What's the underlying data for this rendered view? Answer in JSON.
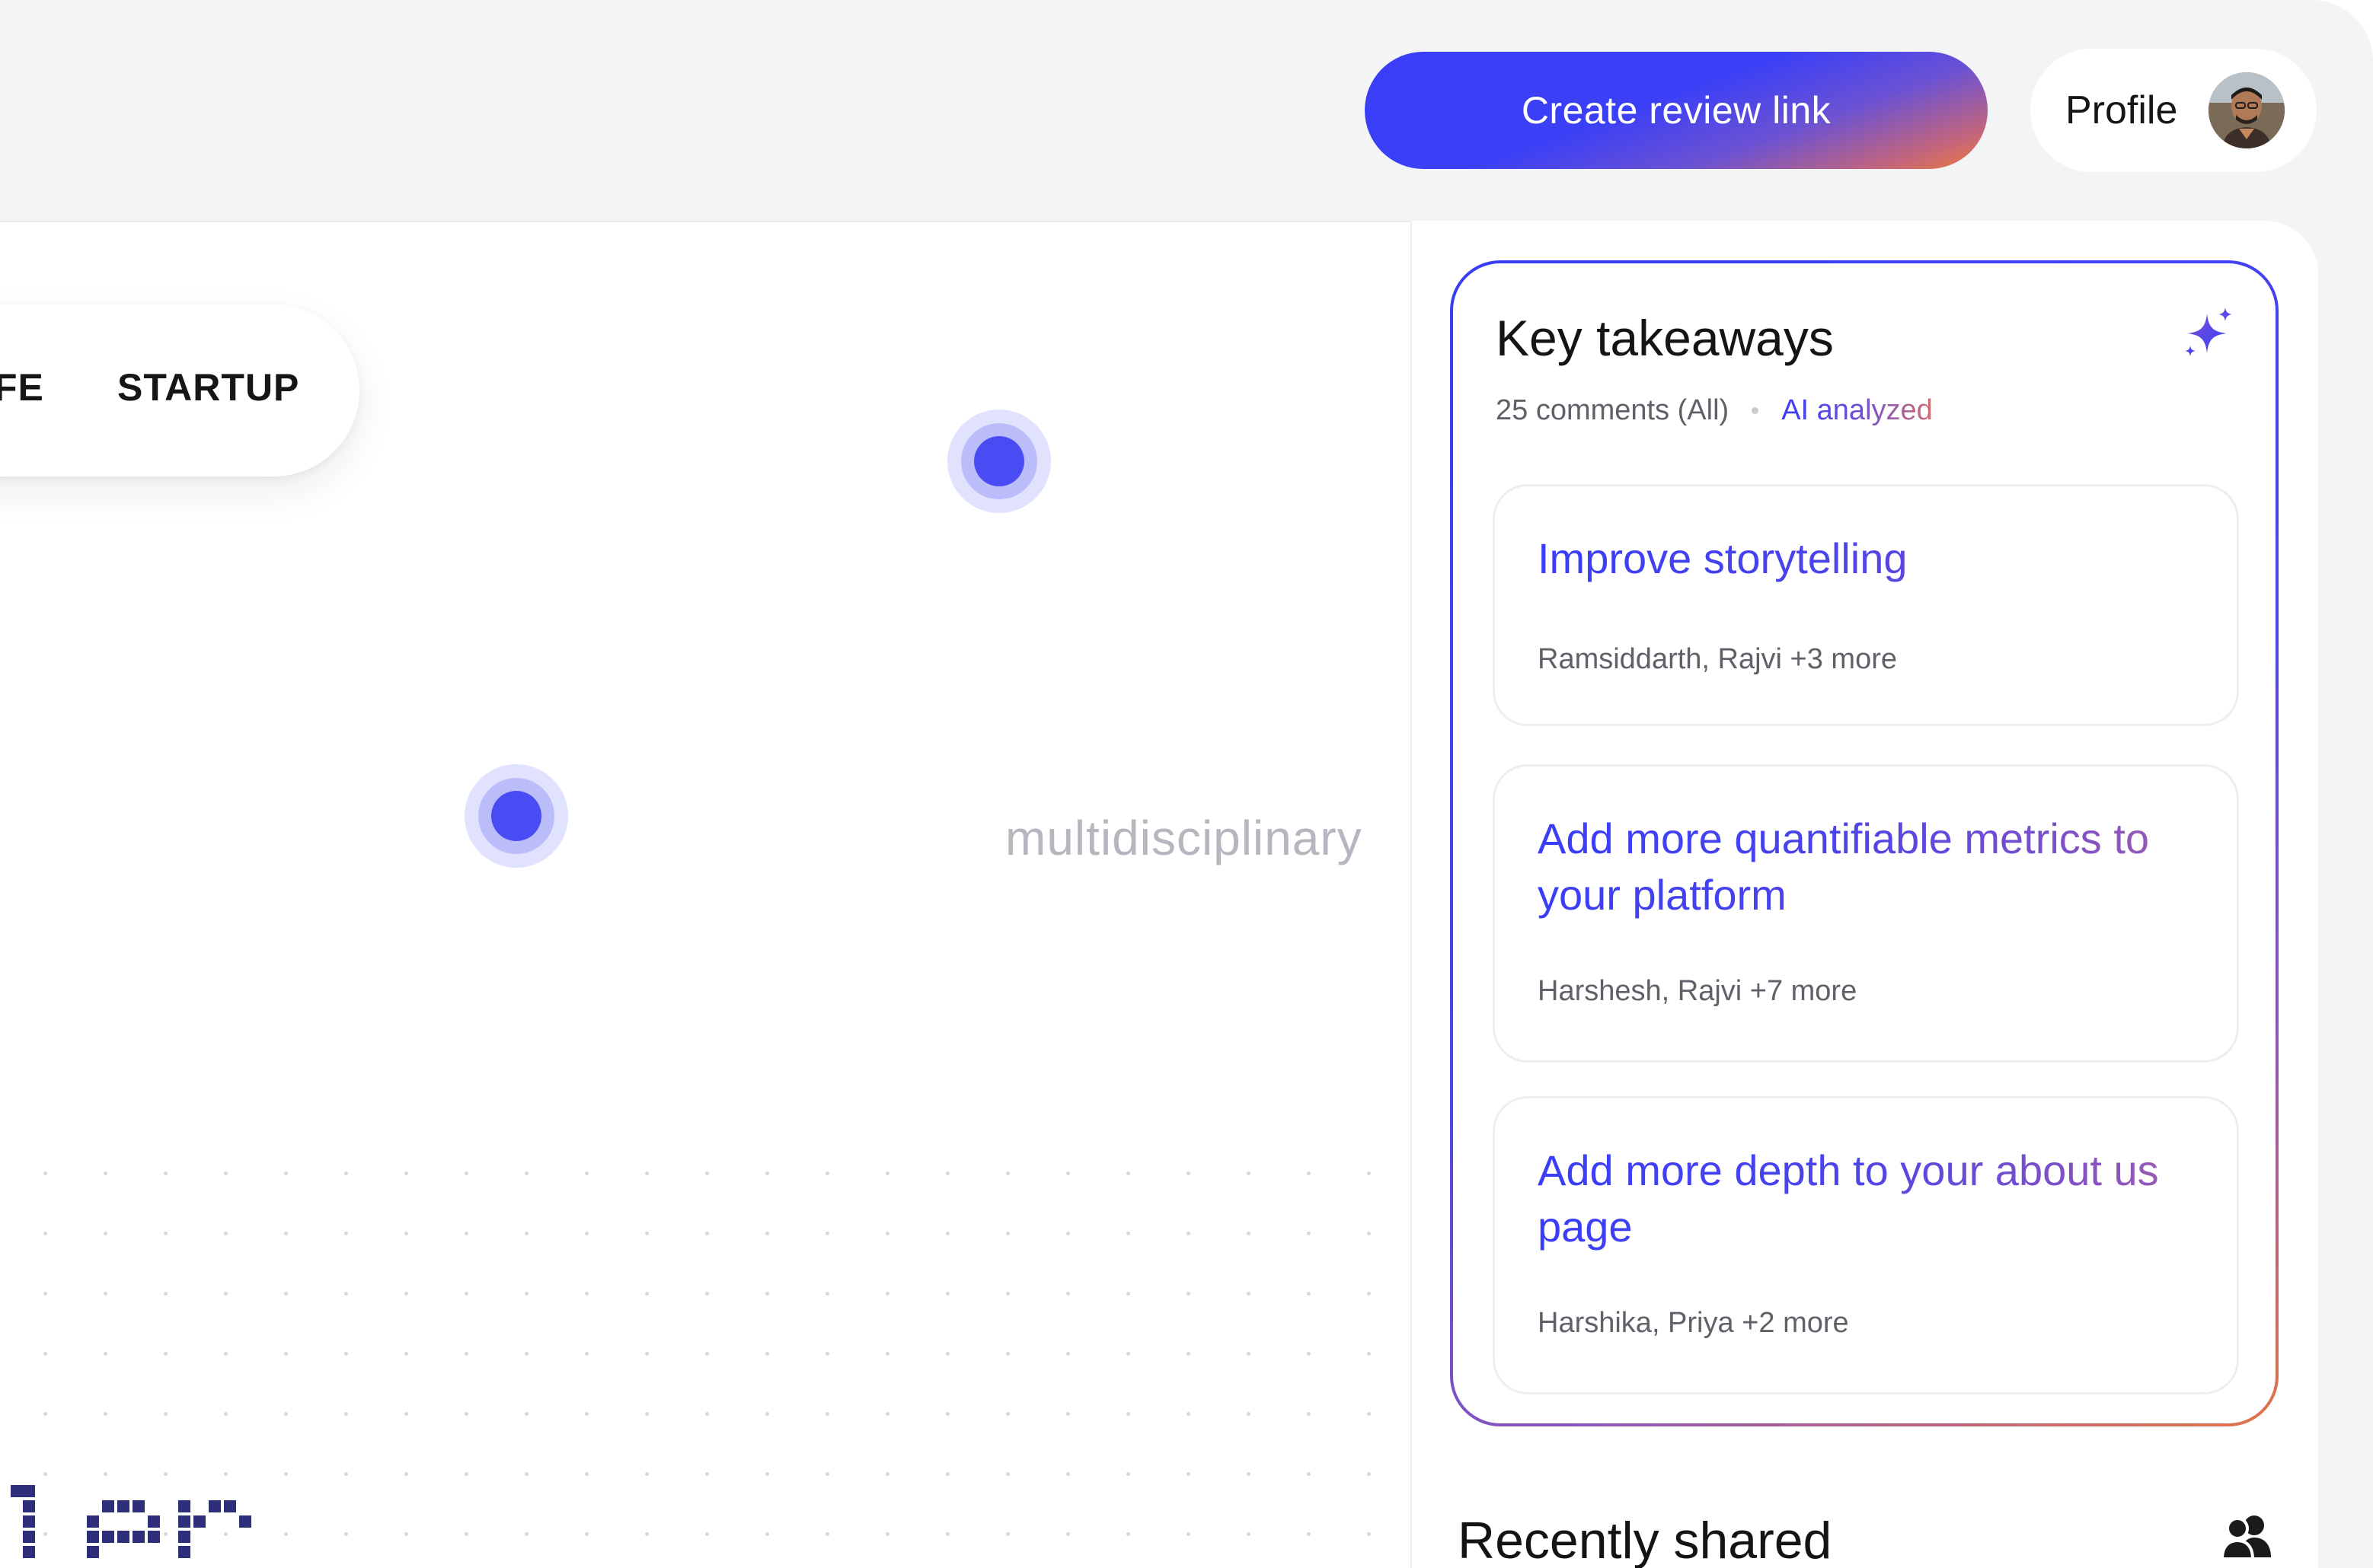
{
  "header": {
    "create_review_link_label": "Create review link",
    "profile_label": "Profile"
  },
  "canvas": {
    "category_items": [
      "FE",
      "STARTUP"
    ],
    "floating_word": "multidisciplinary",
    "pixel_word": "ler"
  },
  "key_takeaways": {
    "title": "Key takeaways",
    "comments_count": "25 comments (All)",
    "ai_label": "AI analyzed",
    "cards": [
      {
        "title": "Improve storytelling",
        "people": "Ramsiddarth, Rajvi +3 more"
      },
      {
        "title": "Add more quantifiable metrics to your platform",
        "people": "Harshesh, Rajvi +7 more"
      },
      {
        "title": "Add more depth to your about us page",
        "people": "Harshika, Priya +2 more"
      }
    ]
  },
  "recently_shared": {
    "title": "Recently shared"
  },
  "icons": {
    "sparkle": "sparkle-icon",
    "people": "people-icon",
    "marker": "location-marker-icon"
  },
  "colors": {
    "accent_blue": "#3a3df7",
    "accent_orange": "#ee7a3b",
    "marker": "#4a4cf3",
    "frame_bg": "#f3f4f6"
  }
}
